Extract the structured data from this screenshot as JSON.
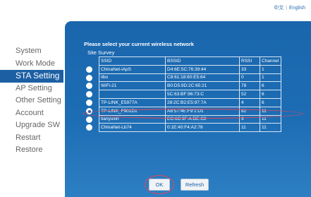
{
  "language": {
    "chinese": "中文",
    "english": "English",
    "separator": "|"
  },
  "sidebar": {
    "items": [
      {
        "label": "System",
        "active": false
      },
      {
        "label": "Work Mode",
        "active": false
      },
      {
        "label": "STA Setting",
        "active": true
      },
      {
        "label": "AP Setting",
        "active": false
      },
      {
        "label": "Other Setting",
        "active": false
      },
      {
        "label": "Account",
        "active": false
      },
      {
        "label": "Upgrade SW",
        "active": false
      },
      {
        "label": "Restart",
        "active": false
      },
      {
        "label": "Restore",
        "active": false
      }
    ]
  },
  "main": {
    "heading": "Please select your current wireless network",
    "subheading": "Site Survey",
    "columns": [
      "SSID",
      "BSSID",
      "RSSI",
      "Channel"
    ],
    "networks": [
      {
        "ssid": "ChinaNet-iApS",
        "bssid": "D4:6E:5C:76:39:44",
        "rssi": "33",
        "channel": "1",
        "selected": false
      },
      {
        "ssid": "libo",
        "bssid": "C8:61:18:60:E5:64",
        "rssi": "0",
        "channel": "1",
        "selected": false
      },
      {
        "ssid": "WiFi-21",
        "bssid": "B0:D5:9D:2C:65:21",
        "rssi": "78",
        "channel": "6",
        "selected": false
      },
      {
        "ssid": "",
        "bssid": "5C:63:BF:96:73:C",
        "rssi": "52",
        "channel": "6",
        "selected": false
      },
      {
        "ssid": "TP-LINK_E5977A",
        "bssid": "28:2C:B2:E5:97:7A",
        "rssi": "4",
        "channel": "6",
        "selected": false
      },
      {
        "ssid": "TP-LINK_F901D1",
        "bssid": "A8:57:4E:F9:1:D1",
        "rssi": "82",
        "channel": "11",
        "selected": true
      },
      {
        "ssid": "tianyuxin",
        "bssid": "EC:6C:9F:A:DE:C2",
        "rssi": "9",
        "channel": "11",
        "selected": false
      },
      {
        "ssid": "ChinaNet-Lb74",
        "bssid": "0:1E:40:F4:A2:78",
        "rssi": "11",
        "channel": "11",
        "selected": false
      }
    ],
    "ok_label": "OK",
    "refresh_label": "Refresh"
  },
  "colors": {
    "panel": "#1d6db4",
    "sidebar_active": "#1c5fa3",
    "annotation_ring": "#e0485a",
    "link": "#2a6fb5"
  }
}
